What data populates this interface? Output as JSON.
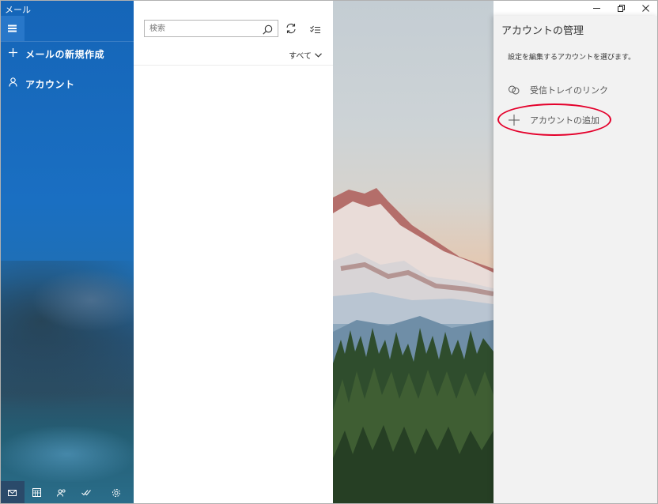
{
  "app": {
    "title": "メール"
  },
  "sidebar": {
    "new_mail": "メールの新規作成",
    "account": "アカウント"
  },
  "list": {
    "search_placeholder": "検索",
    "filter_label": "すべて"
  },
  "panel": {
    "title": "アカウントの管理",
    "subtitle": "設定を編集するアカウントを選びます。",
    "items": [
      {
        "label": "受信トレイのリンク",
        "icon": "link-icon"
      },
      {
        "label": "アカウントの追加",
        "icon": "plus-icon"
      }
    ]
  },
  "bottom_bar": [
    "mail-icon",
    "calendar-icon",
    "people-icon",
    "todo-icon",
    "settings-icon"
  ],
  "colors": {
    "sidebar": "#1a6fc2",
    "highlight": "#e4002b",
    "panel": "#f2f2f2"
  }
}
